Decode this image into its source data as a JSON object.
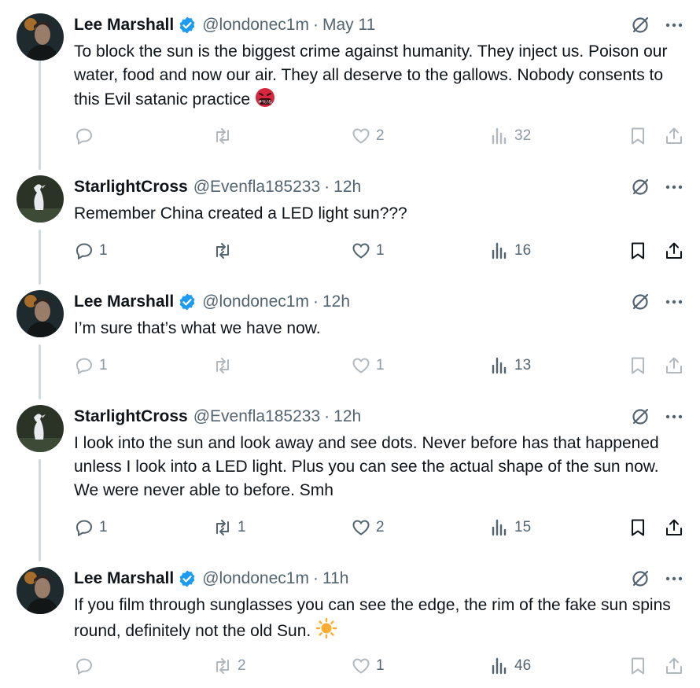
{
  "tweets": [
    {
      "name": "Lee Marshall",
      "verified": true,
      "handle": "@londonec1m",
      "time": "May 11",
      "text": "To block the sun is the biggest crime against humanity. They inject us. Poison our water, food and now our air. They all deserve to the gallows. Nobody consents to this Evil satanic practice",
      "emoji": "face-with-symbols-on-mouth",
      "replies": "",
      "retweets": "",
      "likes": "2",
      "views": "32"
    },
    {
      "name": "StarlightCross",
      "verified": false,
      "handle": "@Evenfla185233",
      "time": "12h",
      "text": "Remember China created a LED light sun???",
      "replies": "1",
      "retweets": "",
      "likes": "1",
      "views": "16"
    },
    {
      "name": "Lee Marshall",
      "verified": true,
      "handle": "@londonec1m",
      "time": "12h",
      "text": "I’m sure that’s what we have now.",
      "replies": "1",
      "retweets": "",
      "likes": "1",
      "views": "13"
    },
    {
      "name": "StarlightCross",
      "verified": false,
      "handle": "@Evenfla185233",
      "time": "12h",
      "text": "I look into the sun and look away and see dots. Never before has that happened unless I look into a LED light. Plus you can see the actual shape of the sun now. We were never able to before. Smh",
      "replies": "1",
      "retweets": "1",
      "likes": "2",
      "views": "15"
    },
    {
      "name": "Lee Marshall",
      "verified": true,
      "handle": "@londonec1m",
      "time": "11h",
      "text": "If you film through sunglasses you can see the edge, the rim of the fake sun spins round, definitely not the old Sun.",
      "emoji": "sun-emoji",
      "replies": "",
      "retweets": "2",
      "likes": "1",
      "views": "46"
    }
  ],
  "separator": "·",
  "colors": {
    "verified": "#1d9bf0",
    "secondary": "#536471",
    "thread_line": "#cfd9de",
    "emoji_red": "#d7263d",
    "sun": "#ffac33"
  }
}
